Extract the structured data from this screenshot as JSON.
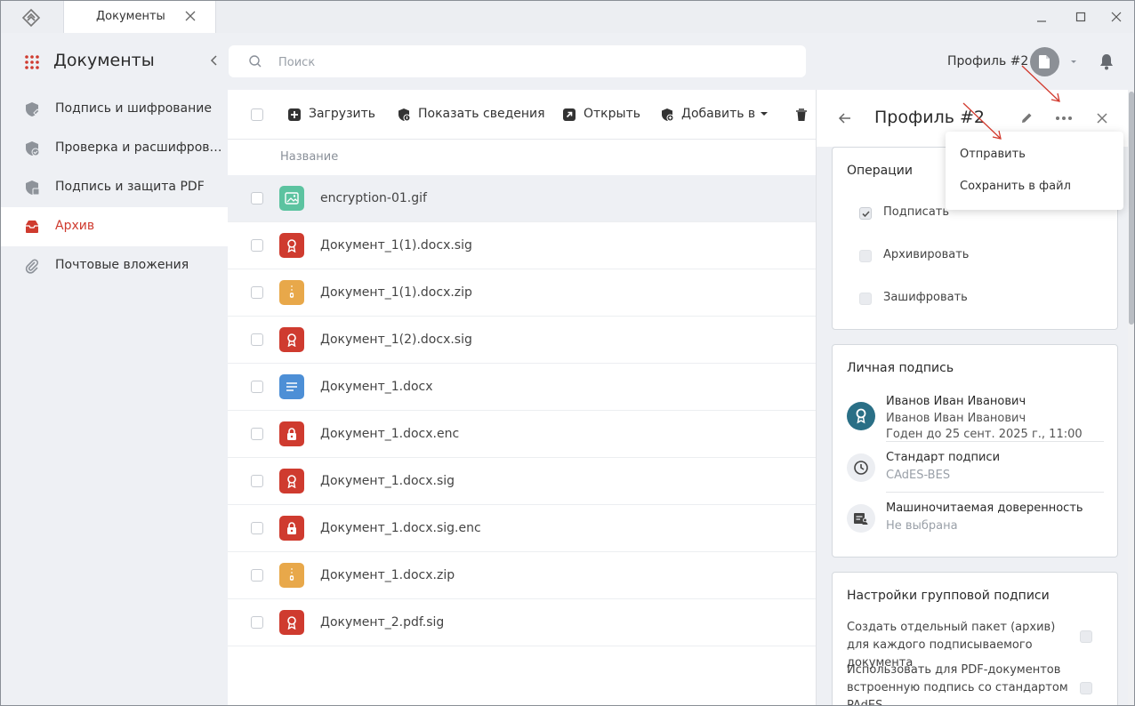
{
  "window": {
    "tab_title": "Документы"
  },
  "sidebar": {
    "title": "Документы",
    "items": [
      {
        "label": "Подпись и шифрование",
        "icon": "shield-pen-icon"
      },
      {
        "label": "Проверка и расшифров…",
        "icon": "shield-check-icon"
      },
      {
        "label": "Подпись и защита PDF",
        "icon": "shield-pdf-icon"
      },
      {
        "label": "Архив",
        "icon": "archive-icon",
        "active": true
      },
      {
        "label": "Почтовые вложения",
        "icon": "paperclip-icon"
      }
    ]
  },
  "search": {
    "placeholder": "Поиск"
  },
  "header": {
    "profile_name": "Профиль #2"
  },
  "toolbar": {
    "upload_label": "Загрузить",
    "details_label": "Показать сведения",
    "open_label": "Открыть",
    "add_label": "Добавить в"
  },
  "file_list": {
    "column_name": "Название",
    "files": [
      {
        "name": "encryption-01.gif",
        "type": "image",
        "selected": true
      },
      {
        "name": "Документ_1(1).docx.sig",
        "type": "sig"
      },
      {
        "name": "Документ_1(1).docx.zip",
        "type": "zip"
      },
      {
        "name": "Документ_1(2).docx.sig",
        "type": "sig"
      },
      {
        "name": "Документ_1.docx",
        "type": "doc"
      },
      {
        "name": "Документ_1.docx.enc",
        "type": "enc"
      },
      {
        "name": "Документ_1.docx.sig",
        "type": "sig"
      },
      {
        "name": "Документ_1.docx.sig.enc",
        "type": "enc"
      },
      {
        "name": "Документ_1.docx.zip",
        "type": "zip"
      },
      {
        "name": "Документ_2.pdf.sig",
        "type": "sig"
      }
    ]
  },
  "panel": {
    "title": "Профиль #2",
    "operations": {
      "title": "Операции",
      "items": [
        {
          "label": "Подписать",
          "checked": true
        },
        {
          "label": "Архивировать",
          "checked": false
        },
        {
          "label": "Зашифровать",
          "checked": false
        }
      ]
    },
    "personal_signature": {
      "title": "Личная подпись",
      "cert_owner": "Иванов Иван Иванович",
      "cert_subject": "Иванов Иван Иванович",
      "cert_valid": "Годен до 25 сент. 2025 г., 11:00",
      "standard_label": "Стандарт подписи",
      "standard_value": "CAdES-BES",
      "poa_label": "Машиночитаемая доверенность",
      "poa_value": "Не выбрана"
    },
    "group_settings": {
      "title": "Настройки групповой подписи",
      "option1": "Создать отдельный пакет (архив) для каждого подписываемого документа",
      "option2": "Использовать для PDF-документов встроенную подпись со стандартом PAdES"
    }
  },
  "menu": {
    "items": [
      "Отправить",
      "Сохранить в файл"
    ]
  },
  "colors": {
    "accent": "#cf3b2f",
    "sig_red": "#cf3b2f",
    "zip_orange": "#e8a84a",
    "doc_blue": "#4d8fd6",
    "image_green": "#5cc3a0",
    "cert_teal": "#2a6f86"
  }
}
